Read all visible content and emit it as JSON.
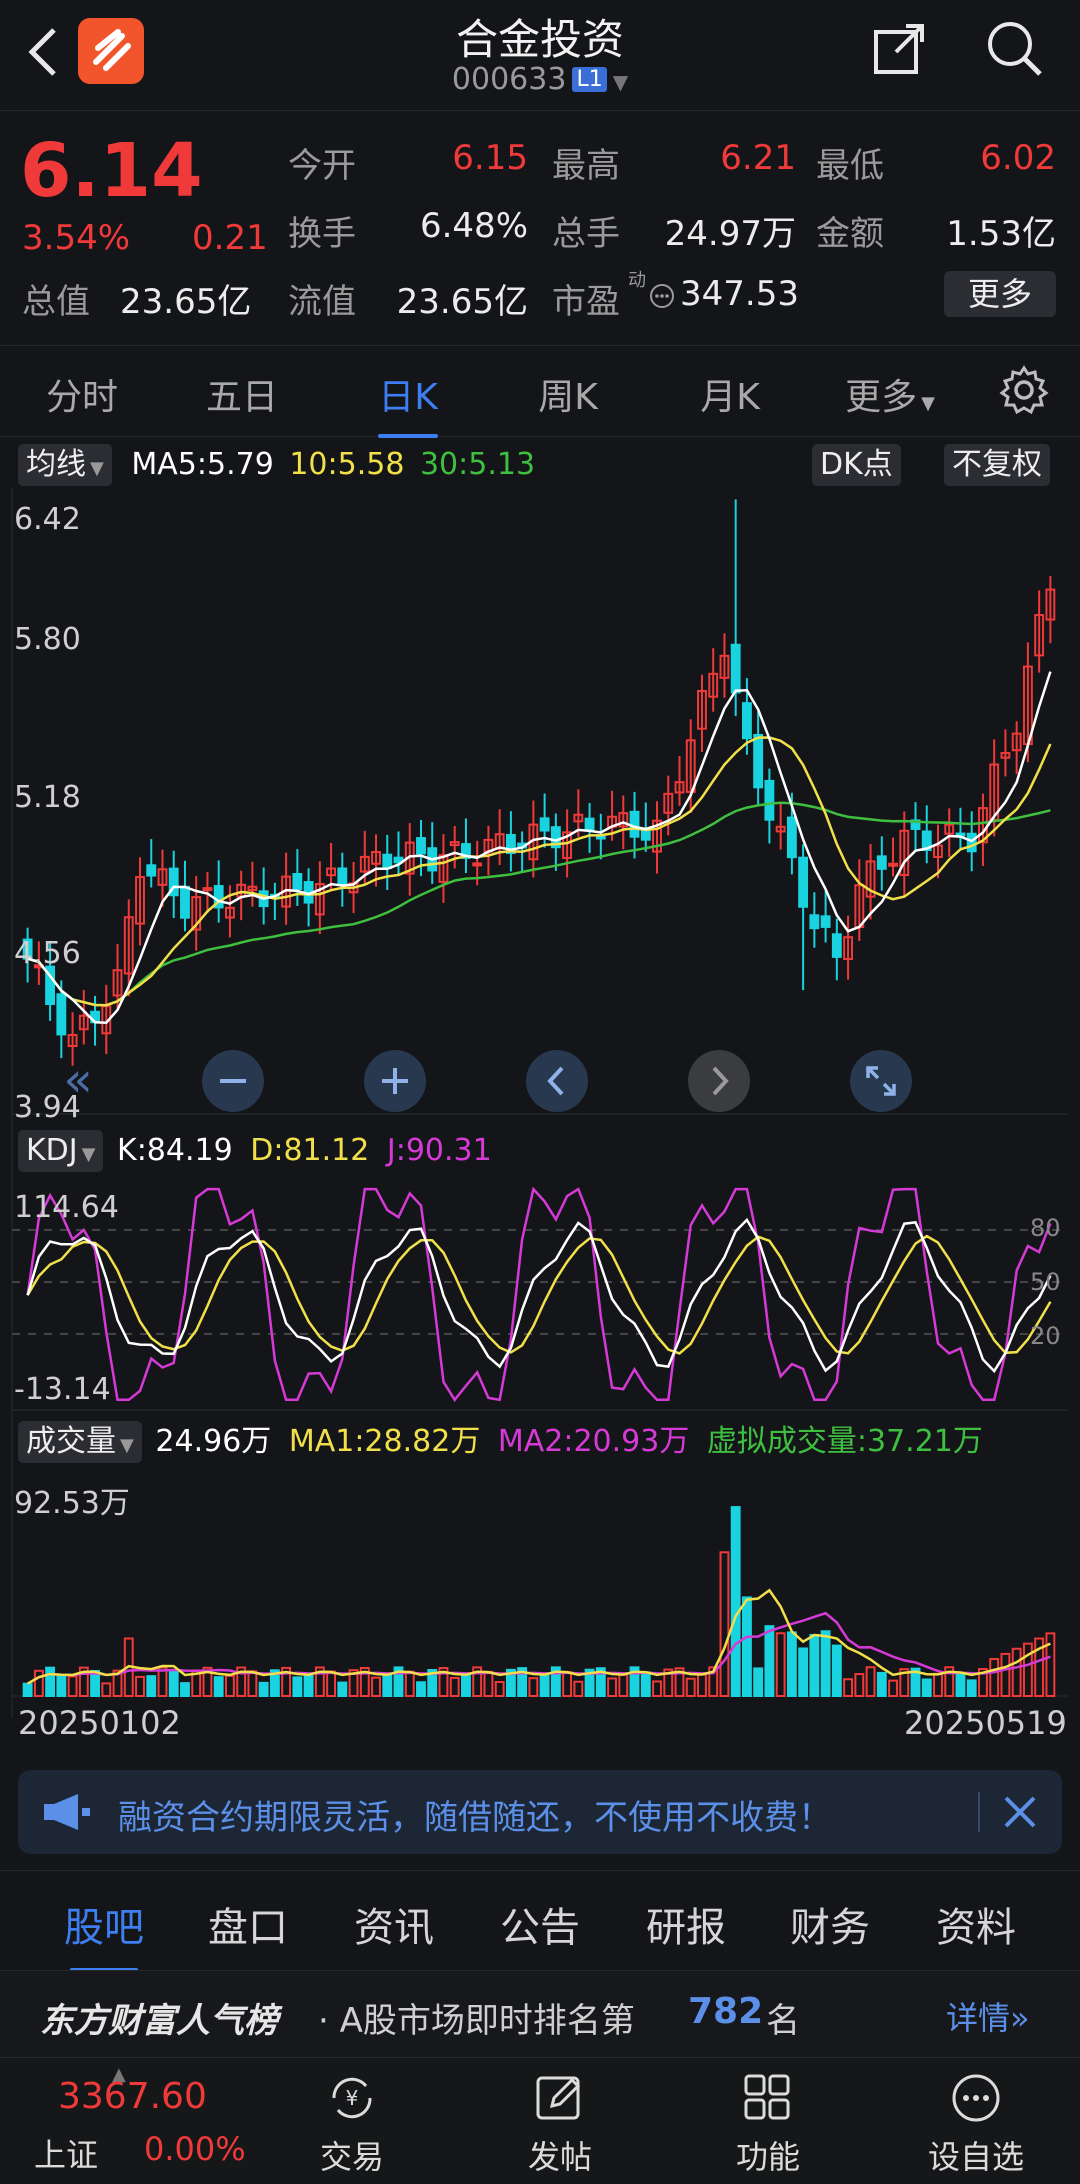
{
  "header": {
    "title": "合金投资",
    "code": "000633",
    "level_tag": "L1"
  },
  "quote": {
    "price": "6.14",
    "change_pct": "3.54%",
    "change_amt": "0.21",
    "total_value_label": "总值",
    "total_value": "23.65亿",
    "fields": [
      {
        "label": "今开",
        "value": "6.15",
        "color": "red"
      },
      {
        "label": "最高",
        "value": "6.21",
        "color": "red"
      },
      {
        "label": "最低",
        "value": "6.02",
        "color": "red"
      },
      {
        "label": "换手",
        "value": "6.48%",
        "color": "white"
      },
      {
        "label": "总手",
        "value": "24.97万",
        "color": "white"
      },
      {
        "label": "金额",
        "value": "1.53亿",
        "color": "white"
      },
      {
        "label": "流值",
        "value": "23.65亿",
        "color": "white"
      },
      {
        "label": "市盈",
        "value": "347.53",
        "color": "white"
      }
    ],
    "pe_superscript": "动",
    "more_label": "更多"
  },
  "chart_tabs": [
    "分时",
    "五日",
    "日K",
    "周K",
    "月K",
    "更多"
  ],
  "active_chart_tab": "日K",
  "ma_legend": {
    "chip": "均线",
    "ma5": "MA5:5.79",
    "ma10": "10:5.58",
    "ma30": "30:5.13",
    "dk_label": "DK点",
    "fq_label": "不复权"
  },
  "kdj_legend": {
    "chip": "KDJ",
    "k": "K:84.19",
    "d": "D:81.12",
    "j": "J:90.31"
  },
  "vol_legend": {
    "chip": "成交量",
    "vol": "24.96万",
    "ma1": "MA1:28.82万",
    "ma2": "MA2:20.93万",
    "virtual": "虚拟成交量:37.21万"
  },
  "colors": {
    "up": "#f03a3a",
    "down": "#19d3e0",
    "ma5": "#ffffff",
    "ma10": "#f2e04a",
    "ma30": "#3fbf3f",
    "j_line": "#d63ad6",
    "accent": "#3d7ff2"
  },
  "chart_data": [
    {
      "type": "candlestick",
      "title": "日K",
      "y_tick_labels": [
        "6.42",
        "5.80",
        "5.18",
        "4.56",
        "3.94"
      ],
      "ylim": [
        3.94,
        6.42
      ],
      "x_start_label": "20250102",
      "x_end_label": "20250519",
      "last_candle": {
        "open": 6.15,
        "high": 6.21,
        "low": 6.02,
        "close": 6.14
      },
      "series": [
        {
          "name": "MA5",
          "last": 5.79
        },
        {
          "name": "MA10",
          "last": 5.58
        },
        {
          "name": "MA30",
          "last": 5.13
        }
      ]
    },
    {
      "type": "line",
      "title": "KDJ",
      "y_tick_labels": [
        "114.64",
        "-13.14"
      ],
      "right_tick_labels": [
        "80",
        "50",
        "20"
      ],
      "ylim": [
        -13.14,
        114.64
      ],
      "series": [
        {
          "name": "K",
          "last": 84.19
        },
        {
          "name": "D",
          "last": 81.12
        },
        {
          "name": "J",
          "last": 90.31
        }
      ]
    },
    {
      "type": "bar",
      "title": "成交量",
      "y_tick_labels": [
        "92.53万"
      ],
      "ylim": [
        0,
        92.53
      ],
      "series": [
        {
          "name": "MA1",
          "last": 28.82
        },
        {
          "name": "MA2",
          "last": 20.93
        }
      ]
    }
  ],
  "chart_controls": [
    "zoom-out",
    "zoom-in",
    "prev",
    "next",
    "fullscreen"
  ],
  "ad": {
    "text": "融资合约期限灵活，随借随还，不使用不收费！"
  },
  "bottom_tabs": [
    "股吧",
    "盘口",
    "资讯",
    "公告",
    "研报",
    "财务",
    "资料"
  ],
  "active_bottom_tab": "股吧",
  "rank": {
    "brand": "东方财富人气榜",
    "text": "· A股市场即时排名第",
    "number": "782",
    "unit": "名",
    "detail": "详情"
  },
  "bottom_nav": {
    "index_value": "3367.60",
    "index_name": "上证",
    "index_change": "0.00%",
    "items": [
      "交易",
      "发帖",
      "功能",
      "设自选"
    ]
  }
}
